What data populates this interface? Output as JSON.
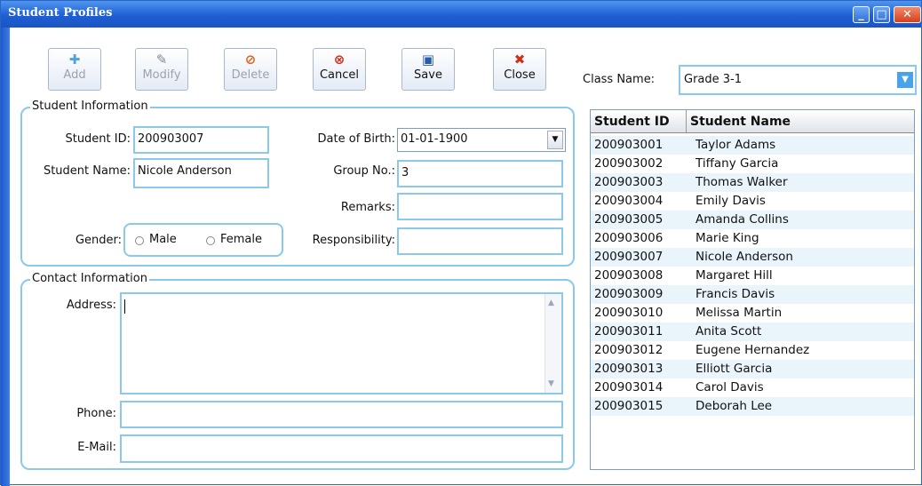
{
  "window": {
    "title": "Student Profiles"
  },
  "toolbar": {
    "add": "Add",
    "modify": "Modify",
    "delete": "Delete",
    "cancel": "Cancel",
    "save": "Save",
    "close": "Close"
  },
  "class_name": {
    "label": "Class Name:",
    "value": "Grade 3-1"
  },
  "student_info": {
    "legend": "Student Information",
    "student_id_label": "Student ID:",
    "student_id": "200903007",
    "student_name_label": "Student Name:",
    "student_name": "Nicole Anderson",
    "dob_label": "Date of Birth:",
    "dob": "01-01-1900",
    "group_label": "Group No.:",
    "group": "3",
    "remarks_label": "Remarks:",
    "remarks": "",
    "responsibility_label": "Responsibility:",
    "responsibility": "",
    "gender_label": "Gender:",
    "male": "Male",
    "female": "Female"
  },
  "contact_info": {
    "legend": "Contact Information",
    "address_label": "Address:",
    "address": "",
    "phone_label": "Phone:",
    "phone": "",
    "email_label": "E-Mail:",
    "email": ""
  },
  "list": {
    "headers": [
      "Student ID",
      "Student Name"
    ],
    "rows": [
      [
        "200903001",
        "Taylor Adams"
      ],
      [
        "200903002",
        "Tiffany  Garcia"
      ],
      [
        "200903003",
        "Thomas Walker"
      ],
      [
        "200903004",
        "Emily Davis"
      ],
      [
        "200903005",
        "Amanda Collins"
      ],
      [
        "200903006",
        "Marie King"
      ],
      [
        "200903007",
        "Nicole Anderson"
      ],
      [
        "200903008",
        "Margaret Hill"
      ],
      [
        "200903009",
        "Francis Davis"
      ],
      [
        "200903010",
        "Melissa Martin"
      ],
      [
        "200903011",
        "Anita  Scott"
      ],
      [
        "200903012",
        "Eugene Hernandez"
      ],
      [
        "200903013",
        "Elliott Garcia"
      ],
      [
        "200903014",
        "Carol Davis"
      ],
      [
        "200903015",
        "Deborah Lee"
      ]
    ]
  }
}
